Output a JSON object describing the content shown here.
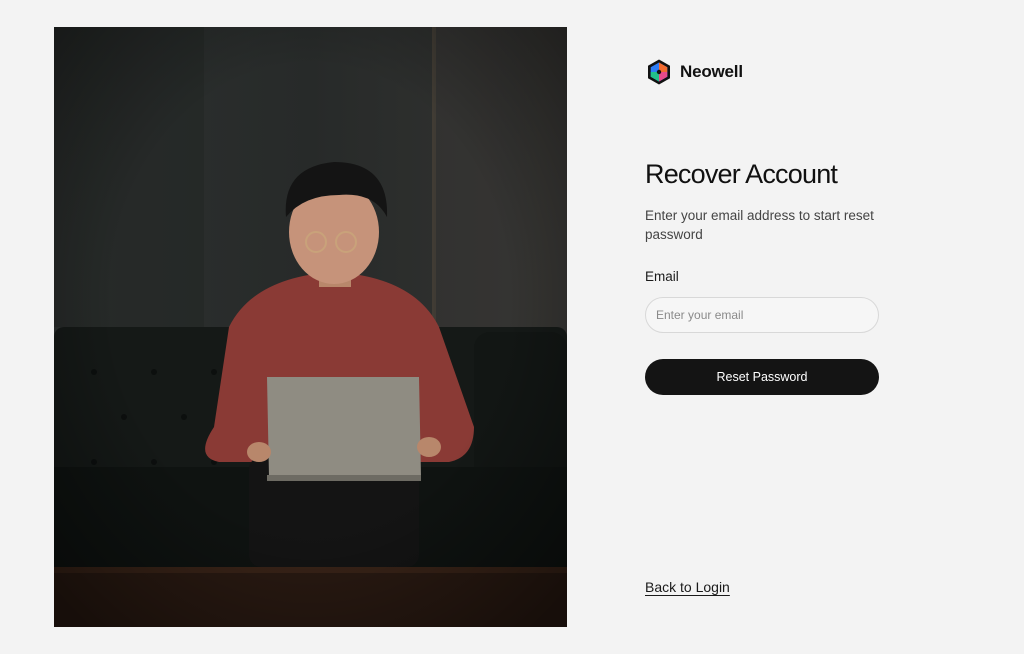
{
  "brand": {
    "name": "Neowell",
    "logo_icon": "hexagon-logo-icon"
  },
  "form": {
    "title": "Recover Account",
    "subtitle": "Enter your email address to start reset password",
    "email_label": "Email",
    "email_placeholder": "Enter your email",
    "email_value": "",
    "submit_label": "Reset Password"
  },
  "footer": {
    "back_link_label": "Back to Login"
  },
  "hero_image": {
    "subject": "person-with-laptop-on-leather-sofa"
  },
  "colors": {
    "background": "#f3f3f3",
    "button": "#141414",
    "button_text": "#ffffff",
    "logo_orange": "#f26a2e",
    "logo_blue": "#2f7df6",
    "logo_green": "#22c08b",
    "logo_pink": "#e84a8a"
  }
}
